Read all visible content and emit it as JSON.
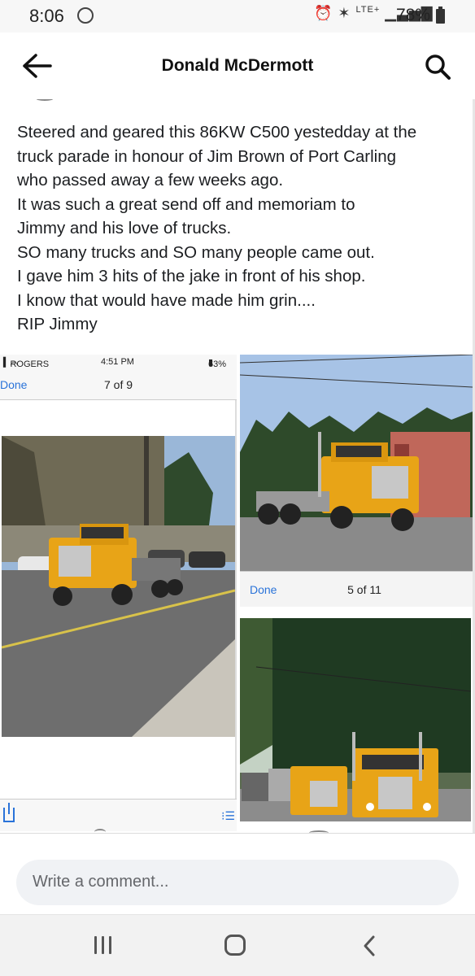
{
  "status_bar": {
    "time": "8:06",
    "network": "LTE+",
    "battery": "78%"
  },
  "app_bar": {
    "title": "Donald McDermott"
  },
  "post": {
    "lines": [
      "Steered and geared this 86KW C500 yestedday at the",
      "truck parade in honour of Jim Brown of Port Carling",
      "who passed away a few weeks ago.",
      "It was such a great send off and memoriam to",
      "Jimmy and his love of trucks.",
      "SO many trucks and SO many people came out.",
      "I gave him 3 hits of the jake in front of his shop.",
      "I know that would have made him grin....",
      "RIP Jimmy"
    ]
  },
  "photo_left": {
    "carrier": "ROGERS",
    "time": "4:51 PM",
    "battery": "63%",
    "done": "Done",
    "counter": "7 of 9"
  },
  "photo_right_top": {
    "done": "Done",
    "counter": "5 of 11"
  },
  "comment": {
    "placeholder": "Write a comment..."
  },
  "colors": {
    "link_blue": "#2a73d9",
    "truck_yellow": "#e8a417"
  },
  "icons": [
    "back-arrow-icon",
    "search-icon",
    "wifi-icon",
    "share-icon",
    "list-icon",
    "recent-apps-icon",
    "home-icon",
    "nav-back-icon"
  ]
}
